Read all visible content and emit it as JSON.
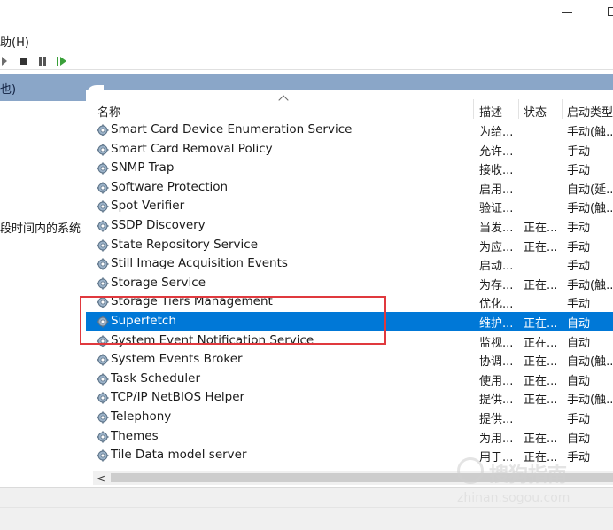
{
  "menu": {
    "help": "助(H)"
  },
  "left_panel": {
    "header": "也)",
    "description_fragment": "段时间内的系统"
  },
  "columns": {
    "name": "名称",
    "desc": "描述",
    "status": "状态",
    "startup": "启动类型"
  },
  "services": [
    {
      "name": "Smart Card Device Enumeration Service",
      "desc": "为给...",
      "status": "",
      "startup": "手动(触..."
    },
    {
      "name": "Smart Card Removal Policy",
      "desc": "允许...",
      "status": "",
      "startup": "手动"
    },
    {
      "name": "SNMP Trap",
      "desc": "接收...",
      "status": "",
      "startup": "手动"
    },
    {
      "name": "Software Protection",
      "desc": "启用...",
      "status": "",
      "startup": "自动(延..."
    },
    {
      "name": "Spot Verifier",
      "desc": "验证...",
      "status": "",
      "startup": "手动(触..."
    },
    {
      "name": "SSDP Discovery",
      "desc": "当发...",
      "status": "正在...",
      "startup": "手动"
    },
    {
      "name": "State Repository Service",
      "desc": "为应...",
      "status": "正在...",
      "startup": "手动"
    },
    {
      "name": "Still Image Acquisition Events",
      "desc": "启动...",
      "status": "",
      "startup": "手动"
    },
    {
      "name": "Storage Service",
      "desc": "为存...",
      "status": "正在...",
      "startup": "手动(触..."
    },
    {
      "name": "Storage Tiers Management",
      "desc": "优化...",
      "status": "",
      "startup": "手动"
    },
    {
      "name": "Superfetch",
      "desc": "维护...",
      "status": "正在...",
      "startup": "自动"
    },
    {
      "name": "System Event Notification Service",
      "desc": "监视...",
      "status": "正在...",
      "startup": "自动"
    },
    {
      "name": "System Events Broker",
      "desc": "协调...",
      "status": "正在...",
      "startup": "自动(触..."
    },
    {
      "name": "Task Scheduler",
      "desc": "使用...",
      "status": "正在...",
      "startup": "自动"
    },
    {
      "name": "TCP/IP NetBIOS Helper",
      "desc": "提供...",
      "status": "正在...",
      "startup": "手动(触..."
    },
    {
      "name": "Telephony",
      "desc": "提供...",
      "status": "",
      "startup": "手动"
    },
    {
      "name": "Themes",
      "desc": "为用...",
      "status": "正在...",
      "startup": "自动"
    },
    {
      "name": "Tile Data model server",
      "desc": "用于...",
      "status": "正在...",
      "startup": "手动"
    }
  ],
  "selected_service": "Superfetch",
  "scrollbar": {
    "left_arrow": "<"
  },
  "watermark": {
    "brand": "搜狗指南",
    "url": "zhinan.sogou.com"
  },
  "colors": {
    "selection": "#0078d7",
    "highlight_box": "#e0393e",
    "header_band": "#8aa6c8"
  },
  "icons": {
    "service": "gear-icon"
  }
}
